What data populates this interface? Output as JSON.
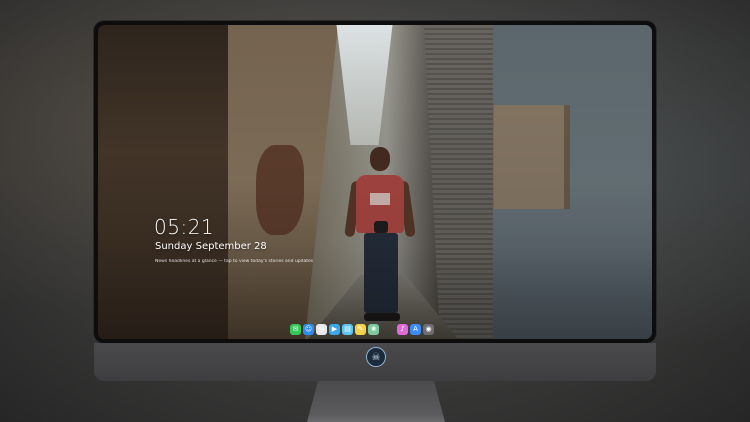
{
  "lockscreen": {
    "time": "05:21",
    "date": "Sunday September  28",
    "news_line": "News headlines at a glance — tap to view today's stories and updates"
  },
  "dock": {
    "items": [
      {
        "name": "messages-icon",
        "glyph": "✉",
        "color": "#34c759"
      },
      {
        "name": "finder-icon",
        "glyph": "☺",
        "color": "#2f8cf0"
      },
      {
        "name": "safari-icon",
        "glyph": "◎",
        "color": "#e8e8ea"
      },
      {
        "name": "videos-icon",
        "glyph": "▶",
        "color": "#3aa7e8"
      },
      {
        "name": "files-icon",
        "glyph": "▤",
        "color": "#5cc6f2"
      },
      {
        "name": "notes-icon",
        "glyph": "✎",
        "color": "#f5d04a"
      },
      {
        "name": "photos-icon",
        "glyph": "❀",
        "color": "#7ec8a0"
      },
      {
        "name": "music-icon",
        "glyph": "♪",
        "color": "#e06bd8"
      },
      {
        "name": "appstore-icon",
        "glyph": "A",
        "color": "#3b8cf5"
      },
      {
        "name": "camera-icon",
        "glyph": "◉",
        "color": "#6e6e72"
      }
    ]
  },
  "monitor": {
    "logo_glyph": "☠"
  }
}
